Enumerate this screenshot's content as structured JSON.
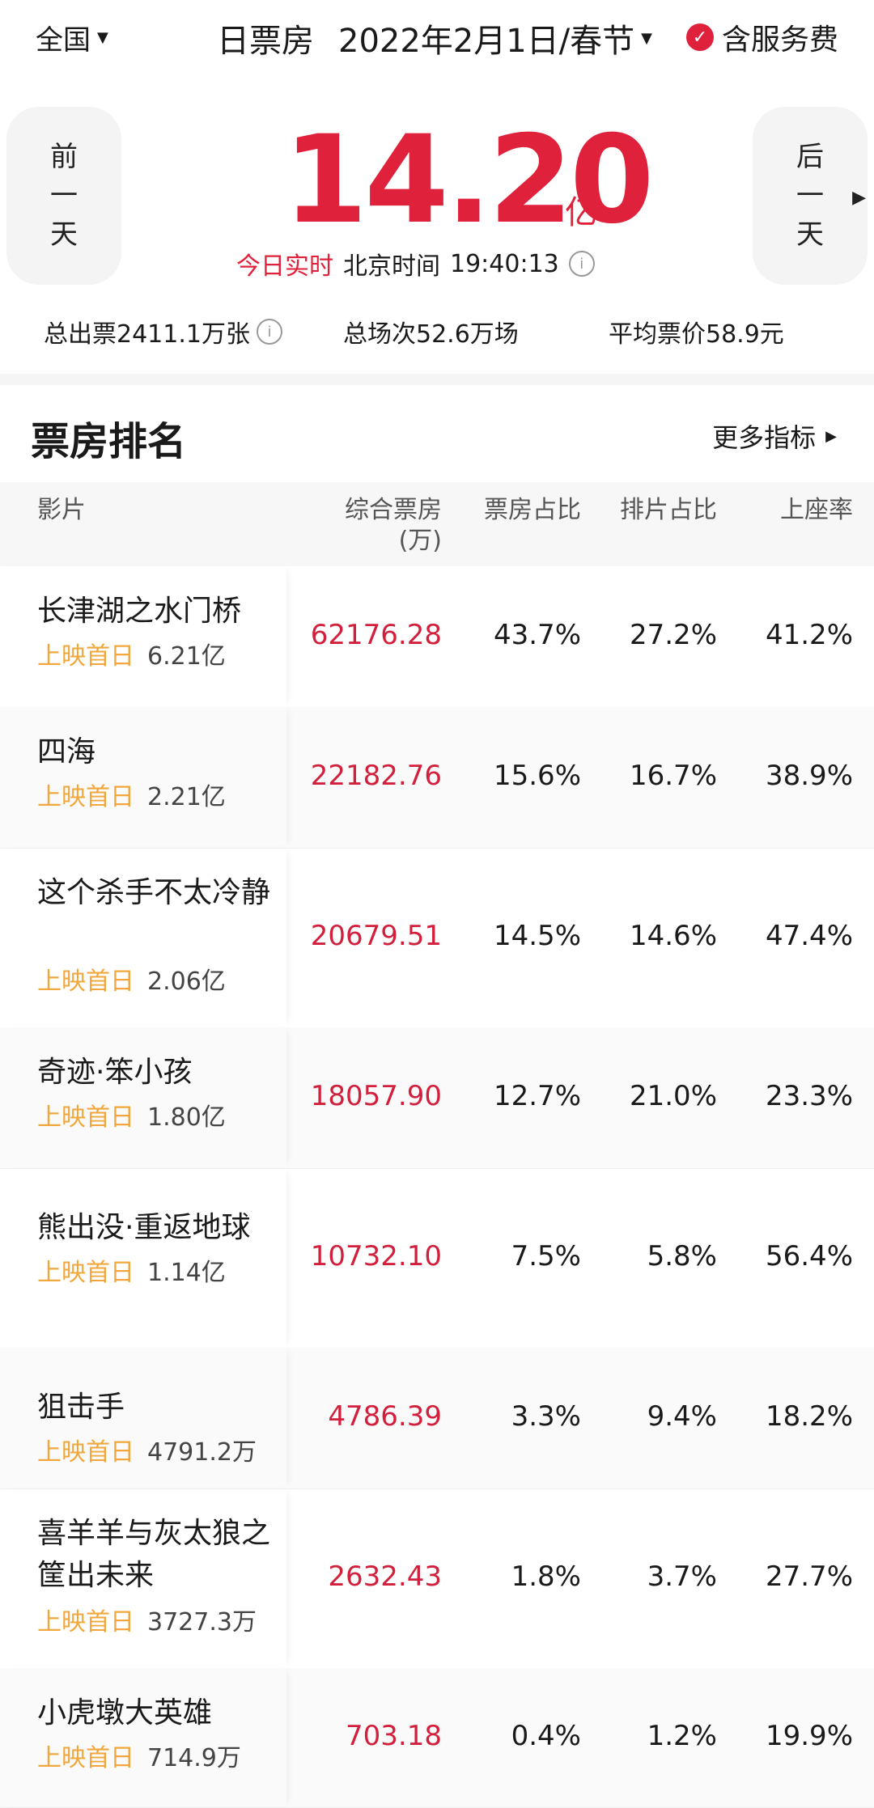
{
  "header": {
    "region": "全国",
    "page_label": "日票房",
    "date": "2022年2月1日/春节",
    "service_fee_label": "含服务费"
  },
  "hero": {
    "prev_label_lines": [
      "前",
      "一",
      "天"
    ],
    "next_label_lines": [
      "后",
      "一",
      "天"
    ],
    "total": "14.20",
    "unit": "亿",
    "realtime_label": "今日实时",
    "timezone_label": "北京时间",
    "time": "19:40:13"
  },
  "stats": {
    "tickets": "总出票2411.1万张",
    "screenings": "总场次52.6万场",
    "avg_price": "平均票价58.9元"
  },
  "section": {
    "title": "票房排名",
    "more_label": "更多指标"
  },
  "table": {
    "headers": {
      "film": "影片",
      "box": "综合票房",
      "box_unit": "(万)",
      "box_share": "票房占比",
      "screen_share": "排片占比",
      "occupancy": "上座率"
    },
    "first_day_label": "上映首日",
    "rows": [
      {
        "title": "长津湖之水门桥",
        "first_day": "6.21亿",
        "box": "62176.28",
        "box_share": "43.7%",
        "screen_share": "27.2%",
        "occupancy": "41.2%"
      },
      {
        "title": "四海",
        "first_day": "2.21亿",
        "box": "22182.76",
        "box_share": "15.6%",
        "screen_share": "16.7%",
        "occupancy": "38.9%"
      },
      {
        "title": "这个杀手不太冷静",
        "first_day": "2.06亿",
        "box": "20679.51",
        "box_share": "14.5%",
        "screen_share": "14.6%",
        "occupancy": "47.4%"
      },
      {
        "title": "奇迹·笨小孩",
        "first_day": "1.80亿",
        "box": "18057.90",
        "box_share": "12.7%",
        "screen_share": "21.0%",
        "occupancy": "23.3%"
      },
      {
        "title": "熊出没·重返地球",
        "first_day": "1.14亿",
        "box": "10732.10",
        "box_share": "7.5%",
        "screen_share": "5.8%",
        "occupancy": "56.4%"
      },
      {
        "title": "狙击手",
        "first_day": "4791.2万",
        "box": "4786.39",
        "box_share": "3.3%",
        "screen_share": "9.4%",
        "occupancy": "18.2%"
      },
      {
        "title": "喜羊羊与灰太狼之筐出未来",
        "first_day": "3727.3万",
        "box": "2632.43",
        "box_share": "1.8%",
        "screen_share": "3.7%",
        "occupancy": "27.7%"
      },
      {
        "title": "小虎墩大英雄",
        "first_day": "714.9万",
        "box": "703.18",
        "box_share": "0.4%",
        "screen_share": "1.2%",
        "occupancy": "19.9%"
      }
    ]
  }
}
